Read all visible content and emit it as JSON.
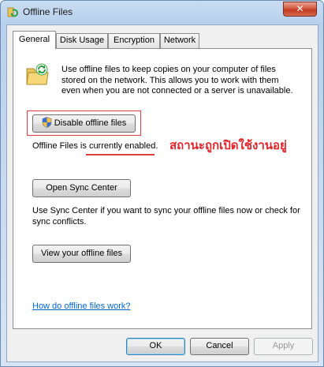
{
  "window": {
    "title": "Offline Files",
    "close_glyph": "✕"
  },
  "tabs": [
    {
      "label": "General",
      "active": true
    },
    {
      "label": "Disk Usage",
      "active": false
    },
    {
      "label": "Encryption",
      "active": false
    },
    {
      "label": "Network",
      "active": false
    }
  ],
  "general": {
    "intro_text": "Use offline files to keep copies on your computer of files stored on the network.  This allows you to work with them even when you are not connected or a server is unavailable.",
    "disable_button_label": "Disable offline files",
    "status_prefix": "Offline Files is ",
    "status_value": "currently enabled",
    "status_suffix": ".",
    "annotation_text": "สถานะถูกเปิดใช้งานอยู่",
    "open_sync_center_label": "Open Sync Center",
    "sync_description": "Use Sync Center if you want to sync your offline files now or check for sync conflicts.",
    "view_files_label": "View your offline files",
    "help_link": "How do offline files work?"
  },
  "footer": {
    "ok_label": "OK",
    "cancel_label": "Cancel",
    "apply_label": "Apply"
  },
  "icons": {
    "app": "offline-files-icon",
    "folder": "sync-folder-icon",
    "shield": "uac-shield-icon",
    "close": "close-icon"
  },
  "colors": {
    "annotation": "#e0242b",
    "link": "#0066cc"
  }
}
